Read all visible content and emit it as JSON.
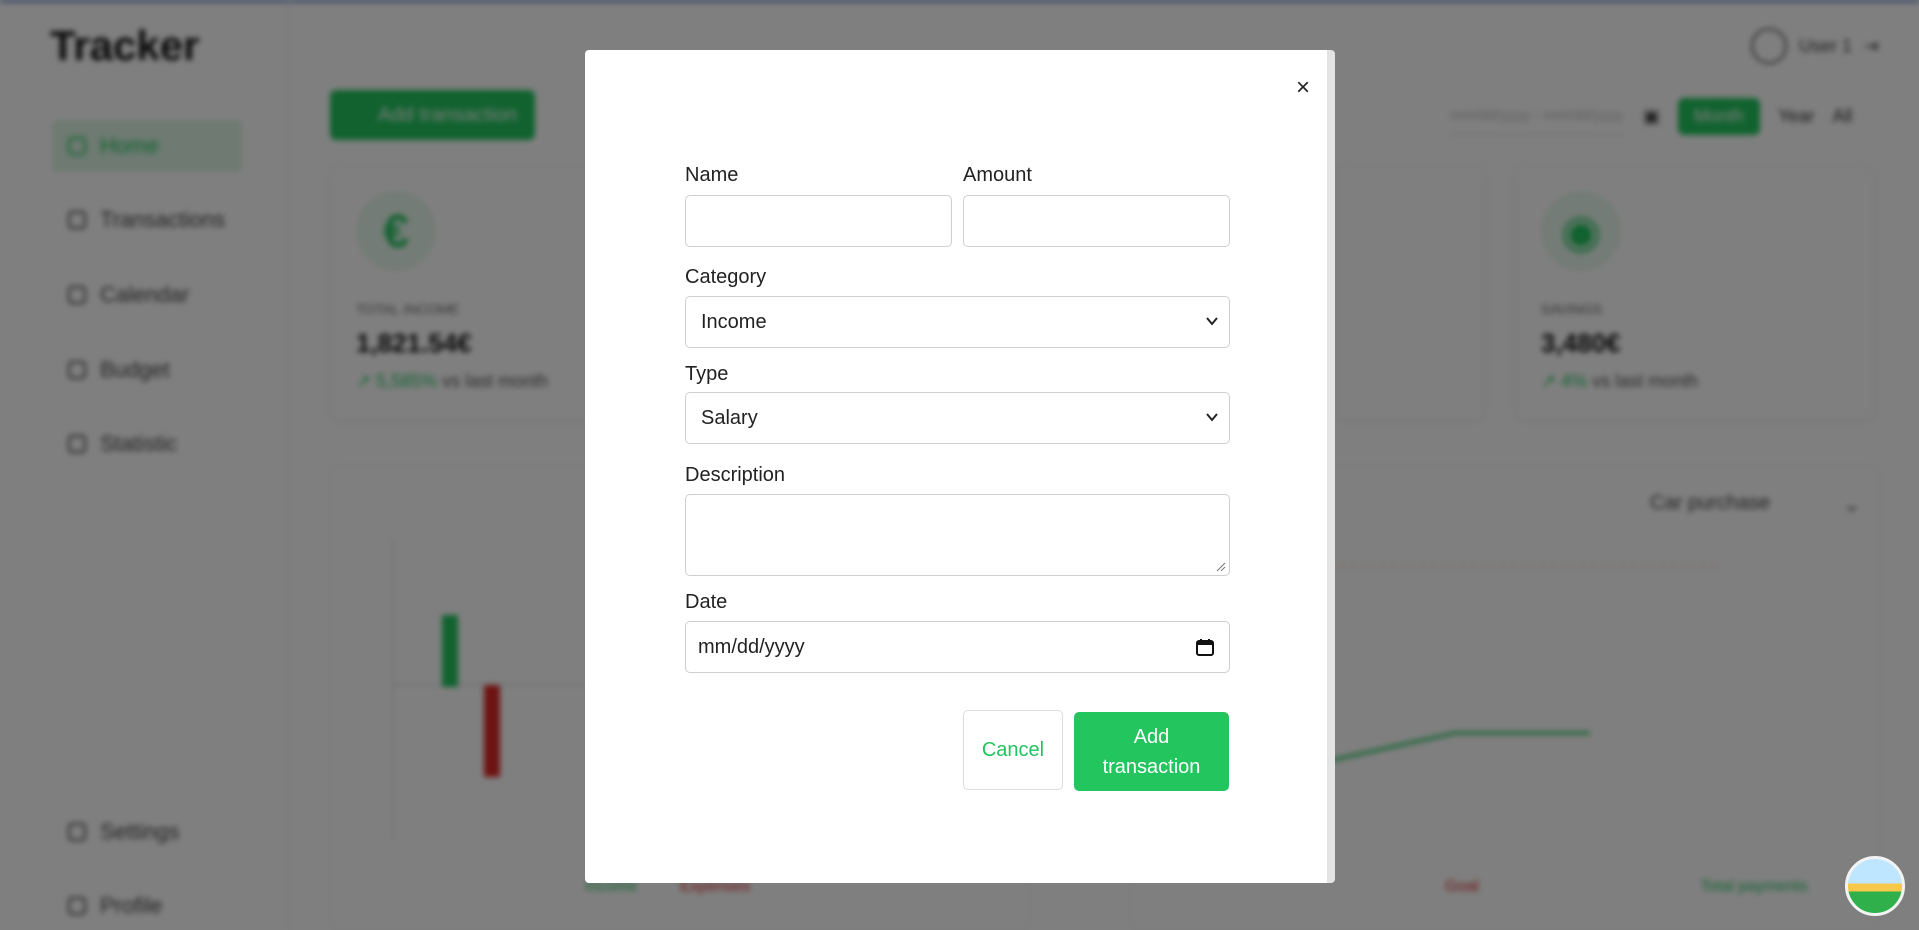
{
  "app": {
    "brand": "Tracker",
    "nav": [
      {
        "label": "Home",
        "icon": "home-icon",
        "active": true
      },
      {
        "label": "Transactions",
        "icon": "transactions-icon"
      },
      {
        "label": "Calendar",
        "icon": "calendar-icon"
      },
      {
        "label": "Budget",
        "icon": "budget-icon"
      },
      {
        "label": "Statistic",
        "icon": "statistic-icon"
      }
    ],
    "nav_bottom": [
      {
        "label": "Settings",
        "icon": "settings-icon"
      },
      {
        "label": "Profile",
        "icon": "profile-icon"
      }
    ],
    "user": "User 1",
    "add_button": "Add transaction",
    "period": {
      "date_placeholder": "mm/dd/yyyy - mm/dd/yyyy",
      "month": "Month",
      "year": "Year",
      "all": "All"
    },
    "cards": [
      {
        "label": "TOTAL INCOME",
        "value": "1,821.54€",
        "trend_value": "↗ 5,585%",
        "trend_text": "vs last month",
        "icon": "€"
      },
      {
        "label": "SAVINGS",
        "value": "3,480€",
        "trend_value": "↗ 4%",
        "trend_text": "vs last month",
        "icon": "piggy-bank-icon"
      }
    ],
    "goal_select": "Car purchase",
    "legend": {
      "income": "Income",
      "expenses": "Expenses",
      "goal": "Goal",
      "total": "Total payments"
    }
  },
  "modal": {
    "fields": {
      "name_label": "Name",
      "name_value": "",
      "amount_label": "Amount",
      "amount_value": "",
      "category_label": "Category",
      "category_value": "Income",
      "type_label": "Type",
      "type_value": "Salary",
      "description_label": "Description",
      "description_value": "",
      "date_label": "Date",
      "date_placeholder": "mm/dd/yyyy"
    },
    "buttons": {
      "cancel": "Cancel",
      "add": "Add transaction",
      "close": "×"
    }
  },
  "colors": {
    "accent": "#22c55e",
    "danger": "#dc2626",
    "overlay": "rgba(0,0,0,0.5)"
  }
}
